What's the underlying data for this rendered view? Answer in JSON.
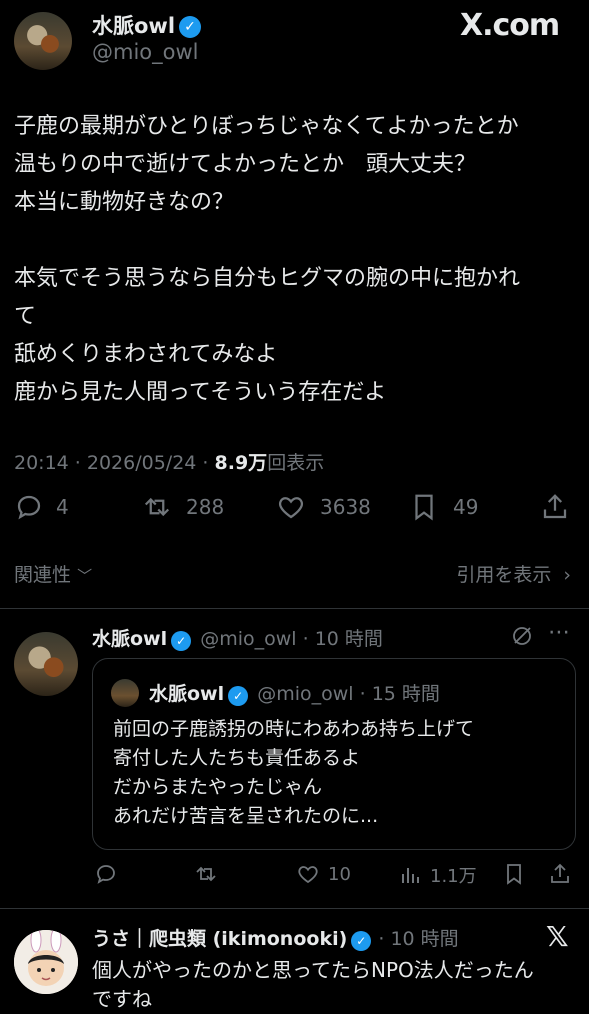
{
  "brand": {
    "logo": "X.com"
  },
  "tweet": {
    "display_name": "水脈owl",
    "handle": "@mio_owl",
    "lines": [
      "子鹿の最期がひとりぼっちじゃなくてよかったとか",
      "温もりの中で逝けてよかったとか　頭大丈夫？",
      "本当に動物好きなの？",
      "",
      "本気でそう思うなら自分もヒグマの腕の中に抱かれ",
      "て",
      "舐めくりまわされてみなよ",
      "鹿から見た人間ってそういう存在だよ"
    ],
    "timestamp": "20:14 · 2026/05/24 · ",
    "views_count": "8.9万",
    "views_label": "回表示",
    "stats": {
      "replies": "4",
      "retweets": "288",
      "likes": "3638",
      "bookmarks": "49"
    },
    "related_label": "関連性",
    "quotes_label": "引用を表示"
  },
  "reply1": {
    "display_name": "水脈owl",
    "handle_time": "@mio_owl · 10 時間",
    "quote": {
      "display_name": "水脈owl",
      "handle_time": "@mio_owl · 15 時間",
      "lines": [
        "前回の子鹿誘拐の時にわあわあ持ち上げて",
        "寄付した人たちも責任あるよ",
        "だからまたやったじゃん",
        "あれだけ苦言を呈されたのに..."
      ]
    },
    "stats": {
      "likes": "10",
      "views": "1.1万"
    }
  },
  "reply2": {
    "display_name": "うさ｜爬虫類 (ikimonooki)",
    "time": "· 10 時間",
    "text_line1": "個人がやったのかと思ってたらNPO法人だったん",
    "text_line2": "ですね"
  },
  "icons": {
    "reply": "speech-bubble-icon",
    "retweet": "retweet-icon",
    "like": "heart-icon",
    "bookmark": "bookmark-icon",
    "share": "share-icon",
    "views": "bar-chart-icon",
    "grok": "grok-icon",
    "more": "more-icon",
    "x_logo": "x-logo-icon"
  },
  "colors": {
    "background": "#000000",
    "text": "#e7e9ea",
    "muted": "#71767b",
    "verified": "#1d9bf0"
  }
}
